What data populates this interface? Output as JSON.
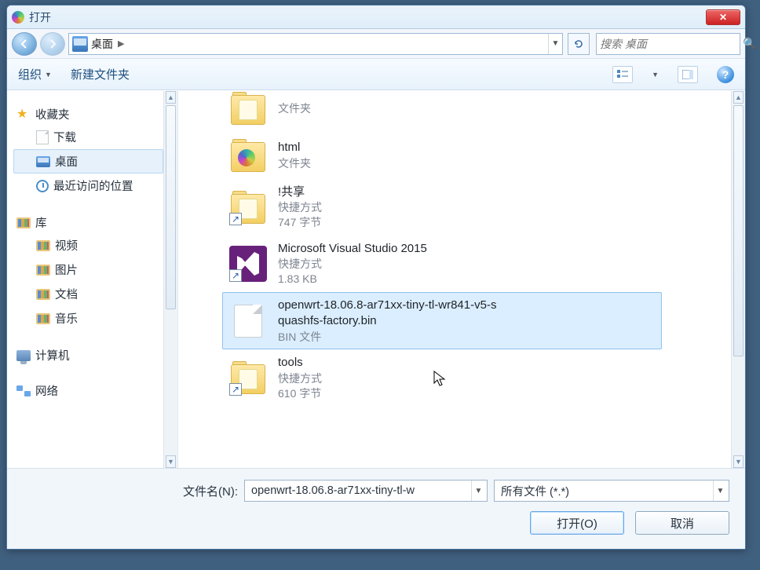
{
  "window": {
    "title": "打开"
  },
  "nav": {
    "location_label": "桌面",
    "search_placeholder": "搜索 桌面"
  },
  "toolbar": {
    "organize": "组织",
    "new_folder": "新建文件夹"
  },
  "sidebar": {
    "favorites": {
      "label": "收藏夹",
      "items": [
        {
          "label": "下载",
          "key": "downloads"
        },
        {
          "label": "桌面",
          "key": "desktop",
          "selected": true
        },
        {
          "label": "最近访问的位置",
          "key": "recent"
        }
      ]
    },
    "libraries": {
      "label": "库",
      "items": [
        {
          "label": "视频",
          "key": "videos"
        },
        {
          "label": "图片",
          "key": "pictures"
        },
        {
          "label": "文档",
          "key": "documents"
        },
        {
          "label": "音乐",
          "key": "music"
        }
      ]
    },
    "computer": {
      "label": "计算机"
    },
    "network": {
      "label": "网络"
    }
  },
  "files": [
    {
      "name": "",
      "type_label": "文件夹",
      "size": "",
      "kind": "folder-partial",
      "selected": false
    },
    {
      "name": "html",
      "type_label": "文件夹",
      "size": "",
      "kind": "folder-html",
      "selected": false
    },
    {
      "name": "!共享",
      "type_label": "快捷方式",
      "size": "747 字节",
      "kind": "folder-shortcut",
      "selected": false
    },
    {
      "name": "Microsoft Visual Studio 2015",
      "type_label": "快捷方式",
      "size": "1.83 KB",
      "kind": "vs-shortcut",
      "selected": false
    },
    {
      "name": "openwrt-18.06.8-ar71xx-tiny-tl-wr841-v5-squashfs-factory.bin",
      "type_label": "BIN 文件",
      "size": "",
      "kind": "file",
      "selected": true
    },
    {
      "name": "tools",
      "type_label": "快捷方式",
      "size": "610 字节",
      "kind": "folder-shortcut",
      "selected": false
    }
  ],
  "footer": {
    "filename_label": "文件名(N):",
    "filename_value": "openwrt-18.06.8-ar71xx-tiny-tl-w",
    "filter_value": "所有文件 (*.*)",
    "open_label": "打开(O)",
    "cancel_label": "取消"
  }
}
